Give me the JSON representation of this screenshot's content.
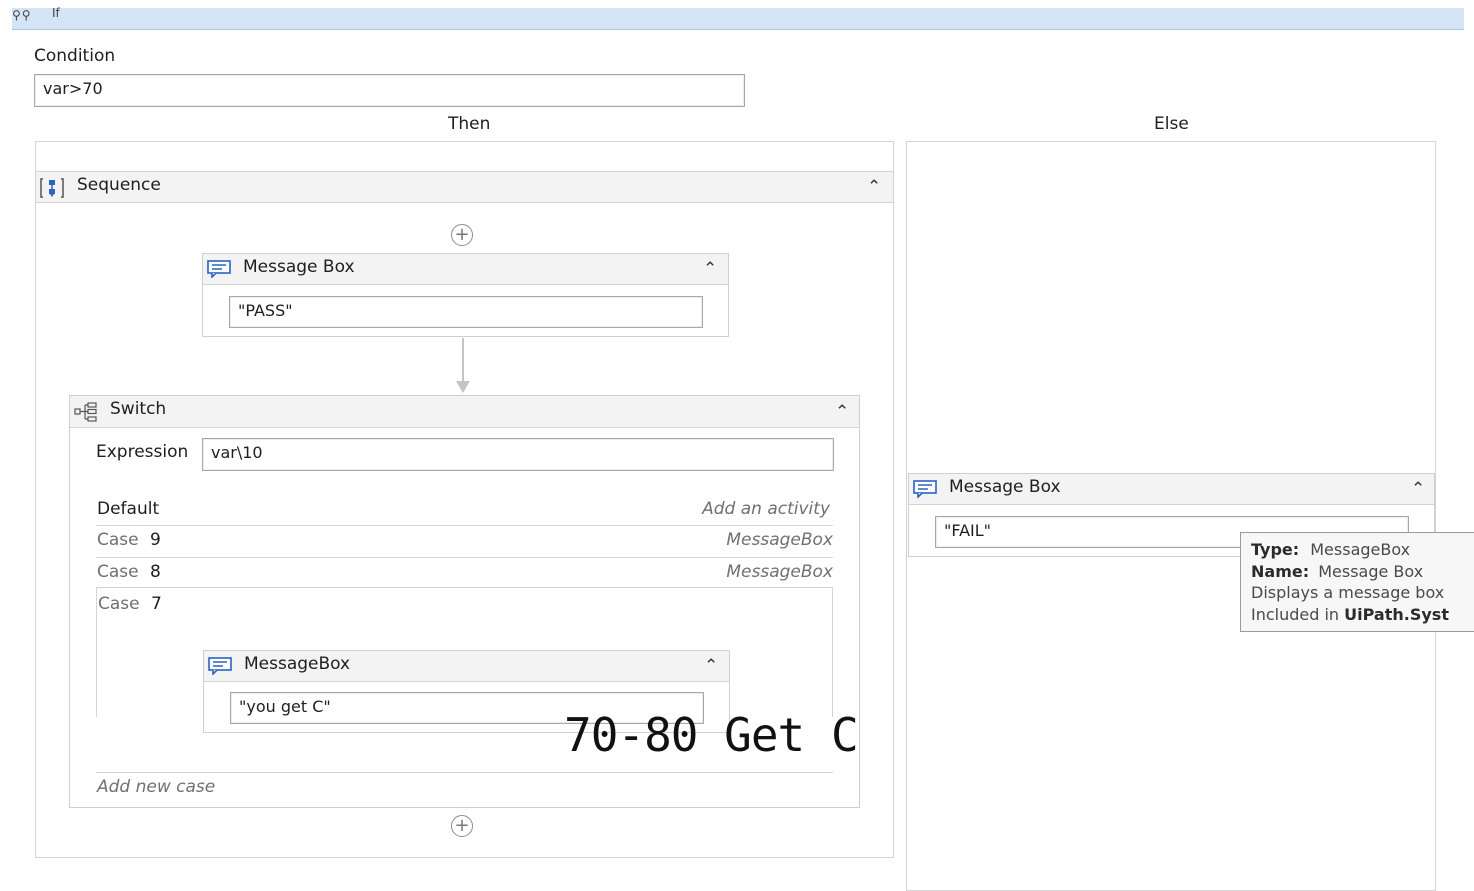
{
  "if_activity": {
    "title": "If",
    "condition_label": "Condition",
    "condition_value": "var>70",
    "then_label": "Then",
    "else_label": "Else"
  },
  "sequence": {
    "title": "Sequence",
    "message_box": {
      "title": "Message Box",
      "text_value": "\"PASS\""
    },
    "switch": {
      "title": "Switch",
      "expression_label": "Expression",
      "expression_value": "var\\10",
      "default_label": "Default",
      "default_hint": "Add an activity",
      "cases": [
        {
          "label": "Case",
          "value": "9",
          "activity": "MessageBox"
        },
        {
          "label": "Case",
          "value": "8",
          "activity": "MessageBox"
        },
        {
          "label": "Case",
          "value": "7"
        }
      ],
      "case7_message_box": {
        "title": "MessageBox",
        "text_value": "\"you get C\""
      },
      "add_new_case": "Add new case"
    }
  },
  "else_message_box": {
    "title": "Message Box",
    "text_value": "\"FAIL\""
  },
  "tooltip": {
    "type_label": "Type:",
    "type_value": "MessageBox",
    "name_label": "Name:",
    "name_value": "Message Box",
    "description": "Displays a message box",
    "included_prefix": "Included in ",
    "included_package": "UiPath.Syst"
  },
  "overlay_text": "70-80 Get C",
  "icons": {
    "if": "if-activity-icon",
    "sequence": "sequence-icon",
    "switch": "switch-icon",
    "message_box": "message-box-icon",
    "collapse": "collapse-chevron-icon",
    "add": "add-activity-icon"
  },
  "colors": {
    "header_bar": "#d3e5f6",
    "activity_header": "#f3f3f3",
    "icon_blue": "#2b63c4",
    "border": "#d4d4d4"
  }
}
